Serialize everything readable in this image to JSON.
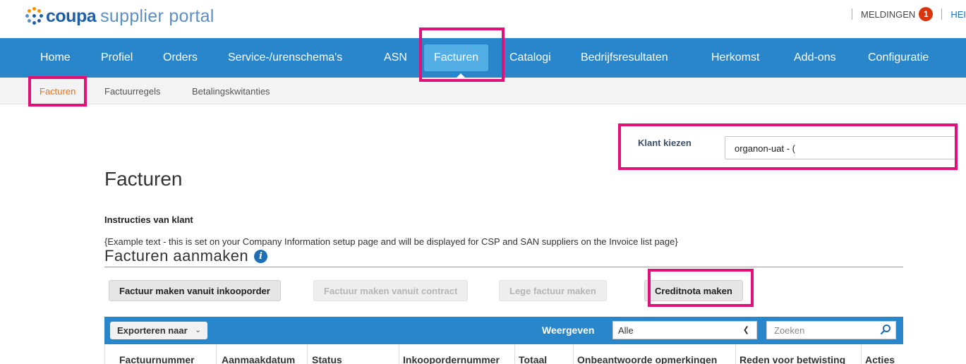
{
  "header": {
    "logo_brand": "coupa",
    "logo_rest": "supplier portal",
    "notifications_label": "MELDINGEN",
    "notifications_count": "1",
    "user_label": "HEI"
  },
  "nav": {
    "items": [
      "Home",
      "Profiel",
      "Orders",
      "Service-/urenschema's",
      "ASN",
      "Facturen",
      "Catalogi",
      "Bedrijfsresultaten",
      "Herkomst",
      "Add-ons",
      "Configuratie"
    ],
    "active": "Facturen"
  },
  "subnav": {
    "items": [
      "Facturen",
      "Factuurregels",
      "Betalingskwitanties"
    ],
    "active": "Facturen"
  },
  "customer": {
    "label": "Klant kiezen",
    "value": "organon-uat - ("
  },
  "page": {
    "title": "Facturen",
    "instructions_title": "Instructies van klant",
    "instructions_text": "{Example text - this is set on your Company Information setup page and will be displayed for CSP and SAN suppliers on the Invoice list page}",
    "create_title": "Facturen aanmaken"
  },
  "buttons": {
    "from_po": "Factuur maken vanuit inkooporder",
    "from_contract": "Factuur maken vanuit contract",
    "blank": "Lege factuur maken",
    "credit_note": "Creditnota maken"
  },
  "table": {
    "export_label": "Exporteren naar",
    "view_label": "Weergeven",
    "view_value": "Alle",
    "search_placeholder": "Zoeken",
    "columns": [
      "Factuurnummer",
      "Aanmaakdatum",
      "Status",
      "Inkoopordernummer",
      "Totaal",
      "Onbeantwoorde opmerkingen",
      "Reden voor betwisting",
      "Acties"
    ]
  },
  "colors": {
    "nav_blue": "#2a86cb",
    "active_tab": "#54aee6",
    "highlight": "#e0127a",
    "subnav_active": "#e8731c",
    "badge": "#d9340b"
  }
}
